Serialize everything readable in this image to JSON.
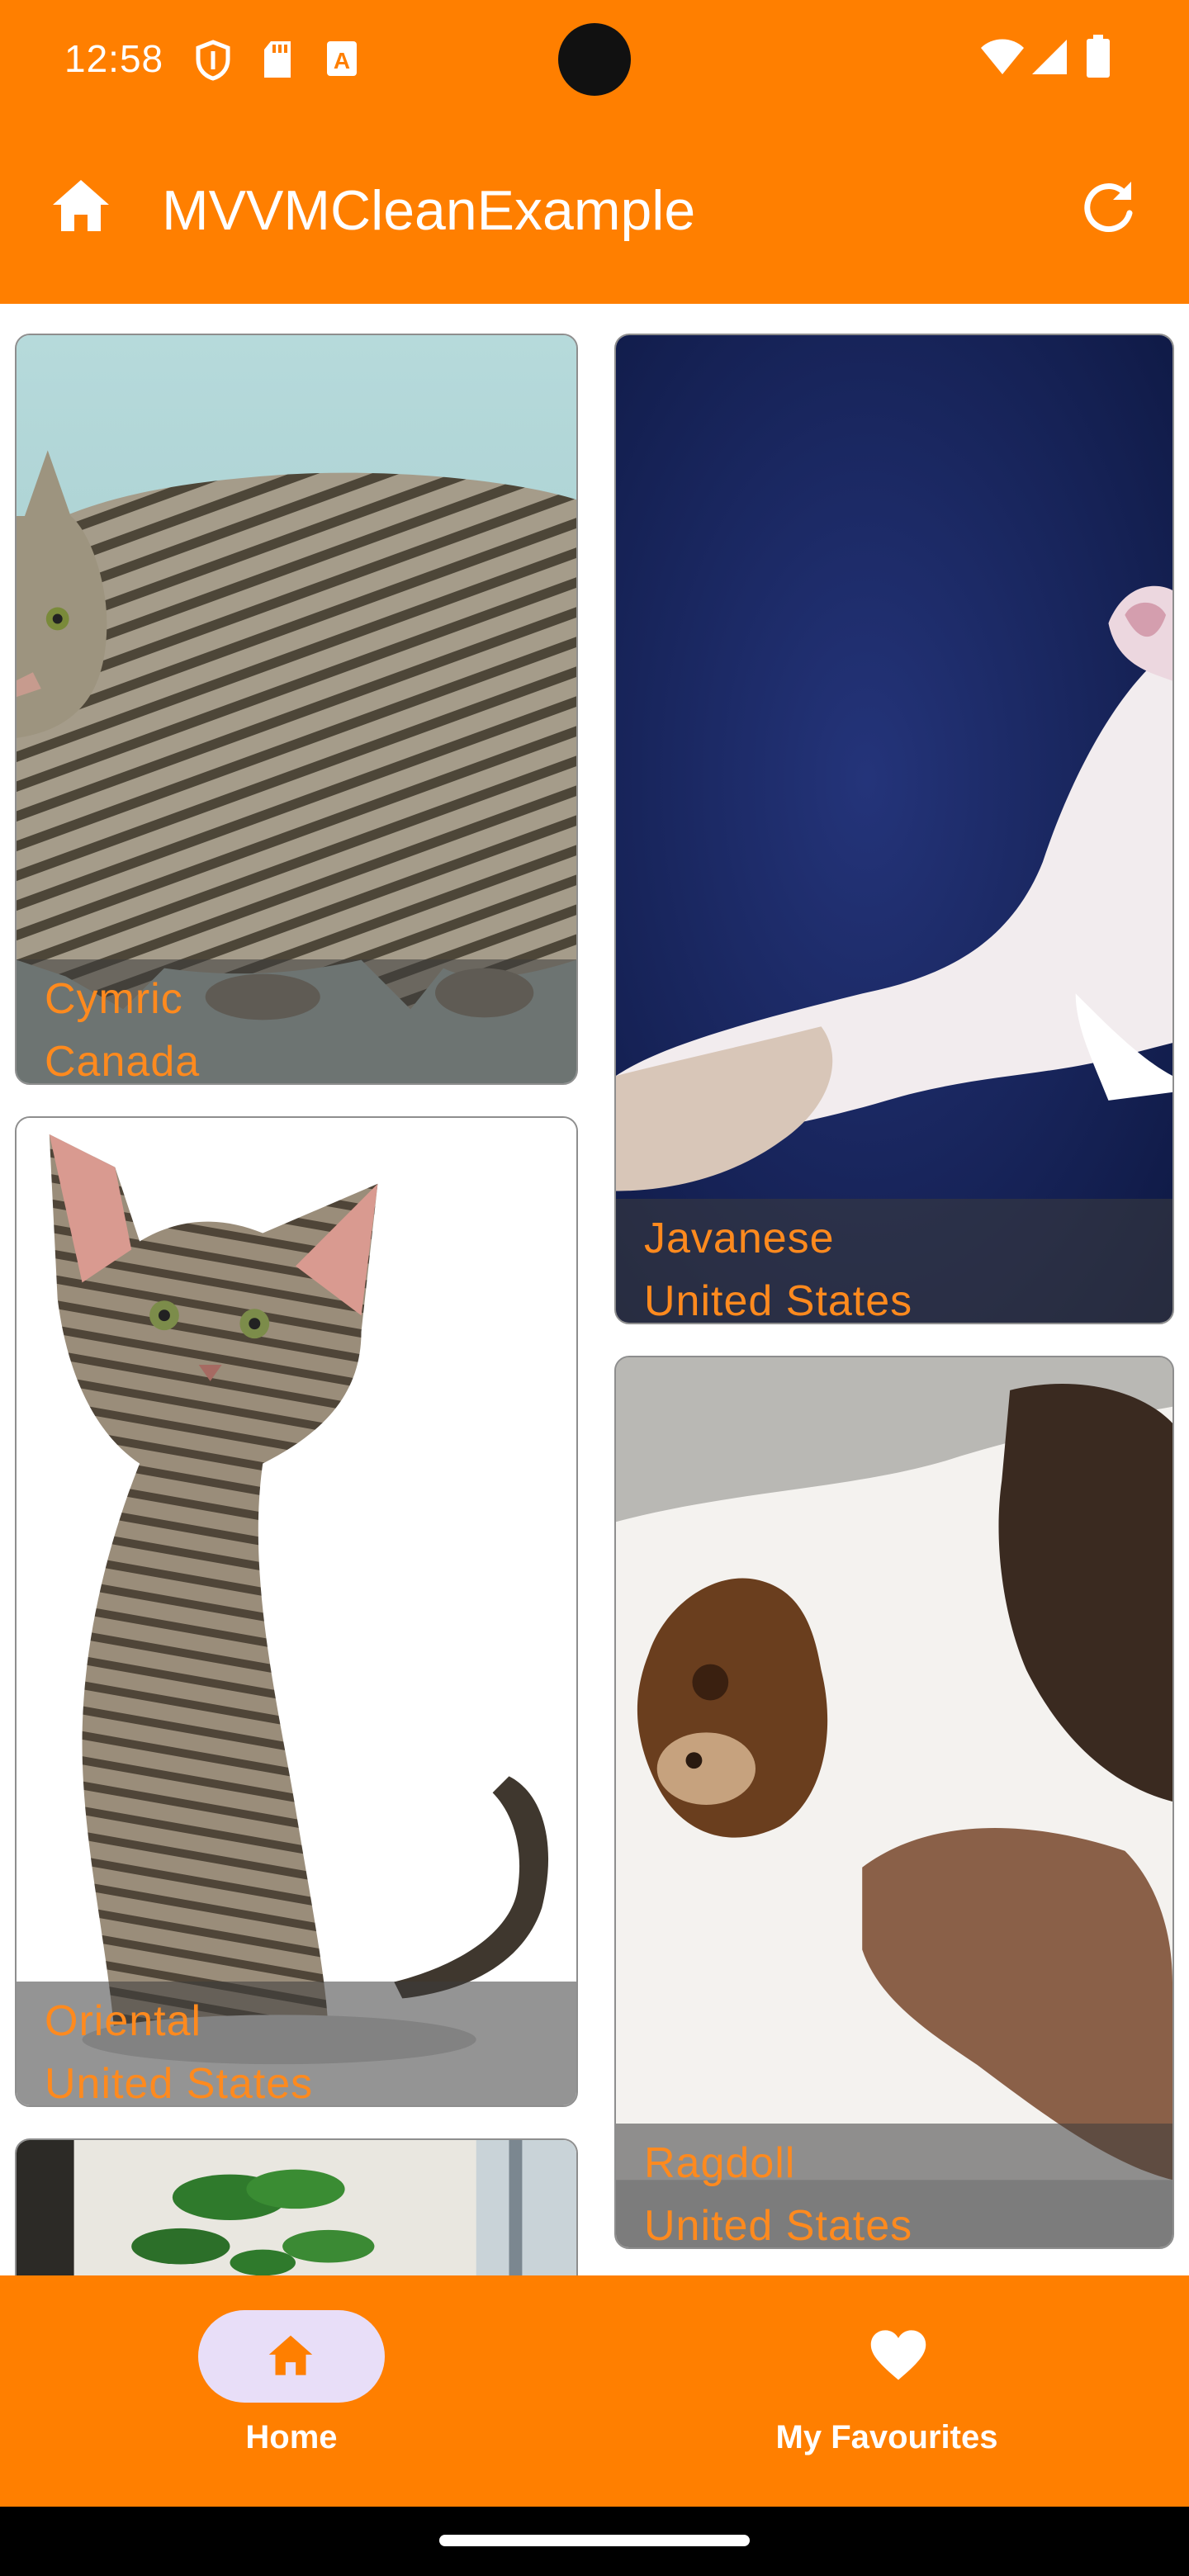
{
  "status_bar": {
    "time": "12:58",
    "icons": [
      "shield-icon",
      "sd-card-icon",
      "text-a-icon",
      "wifi-icon",
      "signal-icon",
      "battery-icon"
    ]
  },
  "app_bar": {
    "title": "MVVMCleanExample",
    "left_icon": "home-icon",
    "right_icon": "refresh-icon"
  },
  "cats": [
    {
      "breed": "Cymric",
      "origin": "Canada"
    },
    {
      "breed": "Javanese",
      "origin": "United States"
    },
    {
      "breed": "Oriental",
      "origin": "United States"
    },
    {
      "breed": "Ragdoll",
      "origin": "United States"
    },
    {
      "breed": "",
      "origin": ""
    }
  ],
  "bottom_nav": {
    "items": [
      {
        "label": "Home",
        "icon": "home-icon",
        "selected": true
      },
      {
        "label": "My Favourites",
        "icon": "heart-icon",
        "selected": false
      }
    ]
  },
  "colors": {
    "primary": "#FF7F00",
    "caption_text": "#FF8A1E",
    "selected_pill": "#E8DEF8"
  }
}
